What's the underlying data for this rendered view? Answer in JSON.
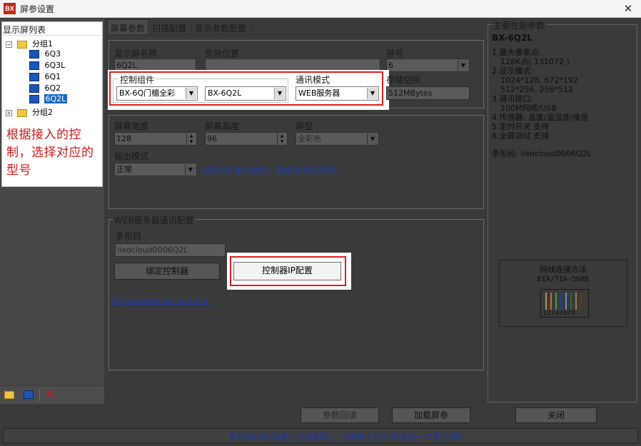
{
  "window": {
    "title": "屏参设置",
    "app_icon": "BX",
    "close": "✕"
  },
  "tree": {
    "header": "显示屏列表",
    "groups": [
      {
        "toggle": "−",
        "label": "分组1",
        "items": [
          "6Q3",
          "6Q3L",
          "6Q1",
          "6Q2",
          "6Q2L"
        ]
      },
      {
        "toggle": "+",
        "label": "分组2",
        "items": []
      }
    ],
    "selected": "6Q2L",
    "annotation": "根据接入的控制，选择对应的型号"
  },
  "tabs": [
    "屏幕参数",
    "扫描配置",
    "显示参数配置"
  ],
  "screen_params": {
    "name_label": "显示屏名称",
    "name_value": "6Q2L",
    "location_label": "安装位置",
    "location_value": "",
    "number_label": "屏号",
    "number_value": "6",
    "controller_label": "控制组件",
    "controller_series": "BX-6Q门楣全彩",
    "controller_model": "BX-6Q2L",
    "comm_label": "通讯模式",
    "comm_value": "WEB服务器",
    "storage_label": "存储空间",
    "storage_value": "512MBytes",
    "width_label": "屏幕宽度",
    "width_value": "128",
    "height_label": "屏幕高度",
    "height_value": "96",
    "type_label": "屏型",
    "type_value": "全彩色",
    "output_label": "输出模式",
    "output_value": "正常",
    "output_hint": "选择对开输出模式，刷新率成倍提高。"
  },
  "web_config": {
    "group_title": "WEB服务器通讯配置",
    "barcode_label": "条形码",
    "barcode_value": "iledcloud0006Q2L",
    "bind_button": "绑定控制器",
    "ip_button": "控制器IP配置",
    "link": "http://www.iledcloud.com"
  },
  "perf": {
    "title": "主要性能参数",
    "model": "BX-6Q2L",
    "lines": [
      "1.最大像素点:",
      "   128K点( 131072 )",
      "2.显示模式:",
      "   1024*128, 672*192",
      "   512*256, 256*512",
      "3.通讯接口:",
      "   100M网络/USB",
      "4.传感器: 温度/温湿度/噪音",
      "5.定时开关 支持",
      "6.全屏测试 支持"
    ],
    "barcode": "条形码: iledcloud0006Q2L",
    "wiring_title": "网线连接方法",
    "wiring_std": "EIA/TIA-568B",
    "wiring_pins": "12345678"
  },
  "bottom": {
    "read_button": "参数回读",
    "load_button": "加载屏参",
    "close_button": "关闭",
    "status": "采用888密码进入当前模式，计算机上只允许连接一个显示屏!"
  },
  "colors": {
    "highlight_red": "#e21c1c",
    "annotation_red": "#d01818",
    "link_blue": "#1d3ea8",
    "status_blue": "#1a38a0"
  }
}
